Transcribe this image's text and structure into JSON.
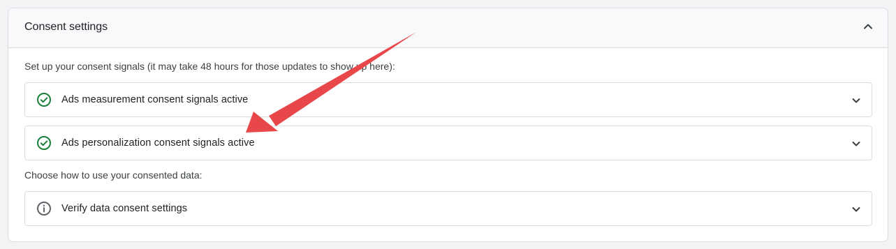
{
  "panel": {
    "title": "Consent settings",
    "collapse_icon": "chevron-up-icon"
  },
  "signals": {
    "instruction": "Set up your consent signals (it may take 48 hours for those updates to show up here):",
    "items": [
      {
        "label": "Ads measurement consent signals active",
        "status": "active",
        "icon": "check-circle-icon"
      },
      {
        "label": "Ads personalization consent signals active",
        "status": "active",
        "icon": "check-circle-icon"
      }
    ]
  },
  "usage": {
    "instruction": "Choose how to use your consented data:",
    "items": [
      {
        "label": "Verify data consent settings",
        "icon": "info-circle-icon"
      }
    ]
  },
  "colors": {
    "success_green": "#188038",
    "info_grey": "#5f6368",
    "annotation_arrow": "#e8474a"
  }
}
